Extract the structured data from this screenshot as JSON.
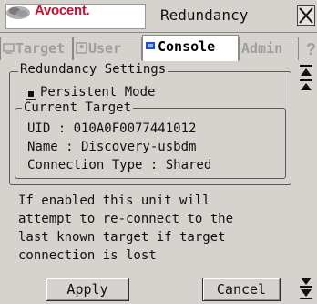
{
  "titlebar": {
    "brand": "Avocent.",
    "title": "Redundancy",
    "close_glyph": "X"
  },
  "tabs": [
    {
      "label": "Target",
      "icon": "target-icon",
      "state": "disabled"
    },
    {
      "label": "User",
      "icon": "user-icon",
      "state": "disabled"
    },
    {
      "label": "Console",
      "icon": "console-icon",
      "state": "active"
    },
    {
      "label": "Admin",
      "icon": "",
      "state": "disabled"
    }
  ],
  "help_glyph": "?",
  "settings": {
    "group_label": "Redundancy Settings",
    "persistent_mode_label": "Persistent Mode",
    "persistent_mode_checked": true
  },
  "current_target": {
    "label": "Current Target",
    "uid": "UID : 010A0F0077441012",
    "name": "Name : Discovery-usbdm",
    "connection_type": "Connection Type : Shared"
  },
  "description": [
    "If enabled this unit will",
    "attempt to re-connect to the",
    "last known target if target",
    "connection is lost"
  ],
  "buttons": {
    "apply": "Apply",
    "cancel": "Cancel"
  },
  "colors": {
    "brand_red": "#c8102e",
    "background": "#d6d3ce",
    "disabled_text": "#9e9e9e"
  }
}
